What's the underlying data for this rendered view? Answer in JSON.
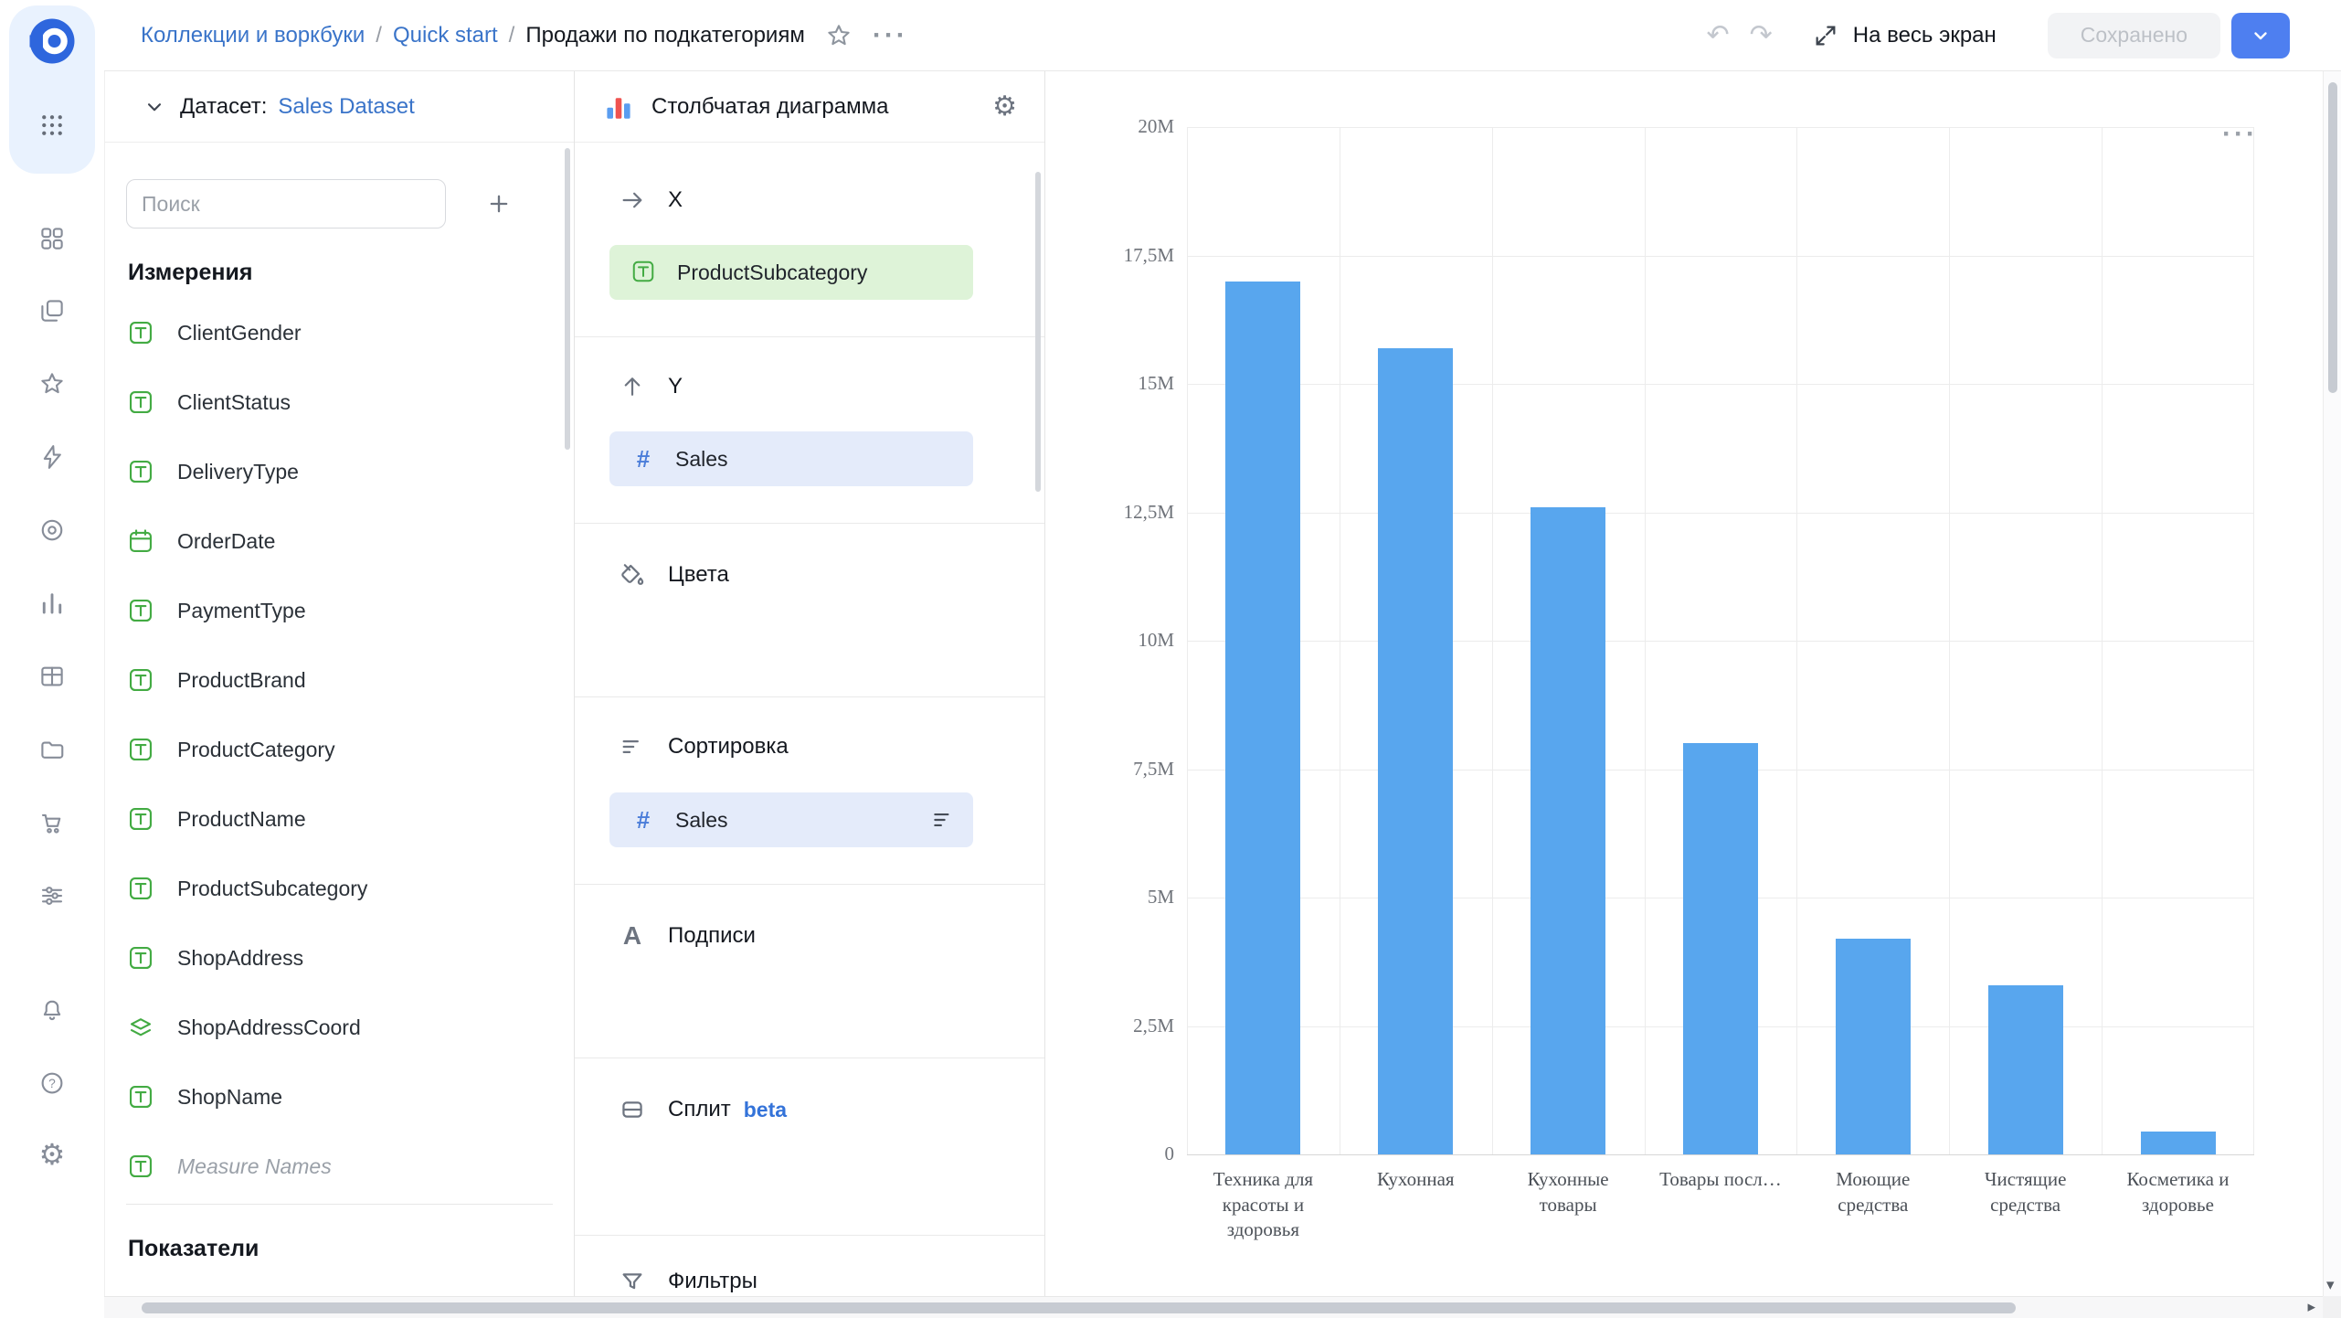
{
  "topbar": {
    "breadcrumb": {
      "root": "Коллекции и воркбуки",
      "workbook": "Quick start",
      "current": "Продажи по подкатегориям",
      "separator": "/"
    },
    "fullscreen_label": "На весь экран",
    "saved_label": "Сохранено"
  },
  "rail_icons": [
    "datalens-logo",
    "apps-grid",
    "dashboards",
    "collections",
    "favorites",
    "quick-actions",
    "scopes",
    "charts",
    "tables",
    "storage",
    "cart",
    "services",
    "notifications",
    "help",
    "settings"
  ],
  "dataset_panel": {
    "dataset_label": "Датасет:",
    "dataset_name": "Sales Dataset",
    "search_placeholder": "Поиск",
    "dimensions_title": "Измерения",
    "measures_title": "Показатели",
    "fields": [
      {
        "name": "ClientGender",
        "icon": "text"
      },
      {
        "name": "ClientStatus",
        "icon": "text"
      },
      {
        "name": "DeliveryType",
        "icon": "text"
      },
      {
        "name": "OrderDate",
        "icon": "date"
      },
      {
        "name": "PaymentType",
        "icon": "text"
      },
      {
        "name": "ProductBrand",
        "icon": "text"
      },
      {
        "name": "ProductCategory",
        "icon": "text"
      },
      {
        "name": "ProductName",
        "icon": "text"
      },
      {
        "name": "ProductSubcategory",
        "icon": "text"
      },
      {
        "name": "ShopAddress",
        "icon": "text"
      },
      {
        "name": "ShopAddressCoord",
        "icon": "geo"
      },
      {
        "name": "ShopName",
        "icon": "text"
      },
      {
        "name": "Measure Names",
        "icon": "text",
        "style": "italic"
      }
    ]
  },
  "wizard": {
    "chart_type_label": "Столбчатая диаграмма",
    "x_label": "X",
    "y_label": "Y",
    "colors_label": "Цвета",
    "sort_label": "Сортировка",
    "captions_label": "Подписи",
    "split_label": "Сплит",
    "split_badge": "beta",
    "filters_label": "Фильтры",
    "x_pill": "ProductSubcategory",
    "y_pill": "Sales",
    "sort_pill": "Sales",
    "hash": "#"
  },
  "chart_data": {
    "type": "bar",
    "title": "",
    "x_field": "ProductSubcategory",
    "y_field": "Sales",
    "categories": [
      "Техника для красоты и здоровья",
      "Кухонная",
      "Кухонные товары",
      "Товары посл…",
      "Моющие средства",
      "Чистящие средства",
      "Косметика и здоровье"
    ],
    "series": [
      {
        "name": "Sales",
        "values": [
          17000000,
          15700000,
          12600000,
          8000000,
          4200000,
          3300000,
          450000
        ]
      }
    ],
    "y_ticks": [
      "20M",
      "17,5M",
      "15M",
      "12,5M",
      "10M",
      "7,5M",
      "5M",
      "2,5M",
      "0"
    ],
    "ylim": [
      0,
      20000000
    ],
    "bar_color": "#58a6ee",
    "grid": true,
    "legend_position": "none"
  }
}
